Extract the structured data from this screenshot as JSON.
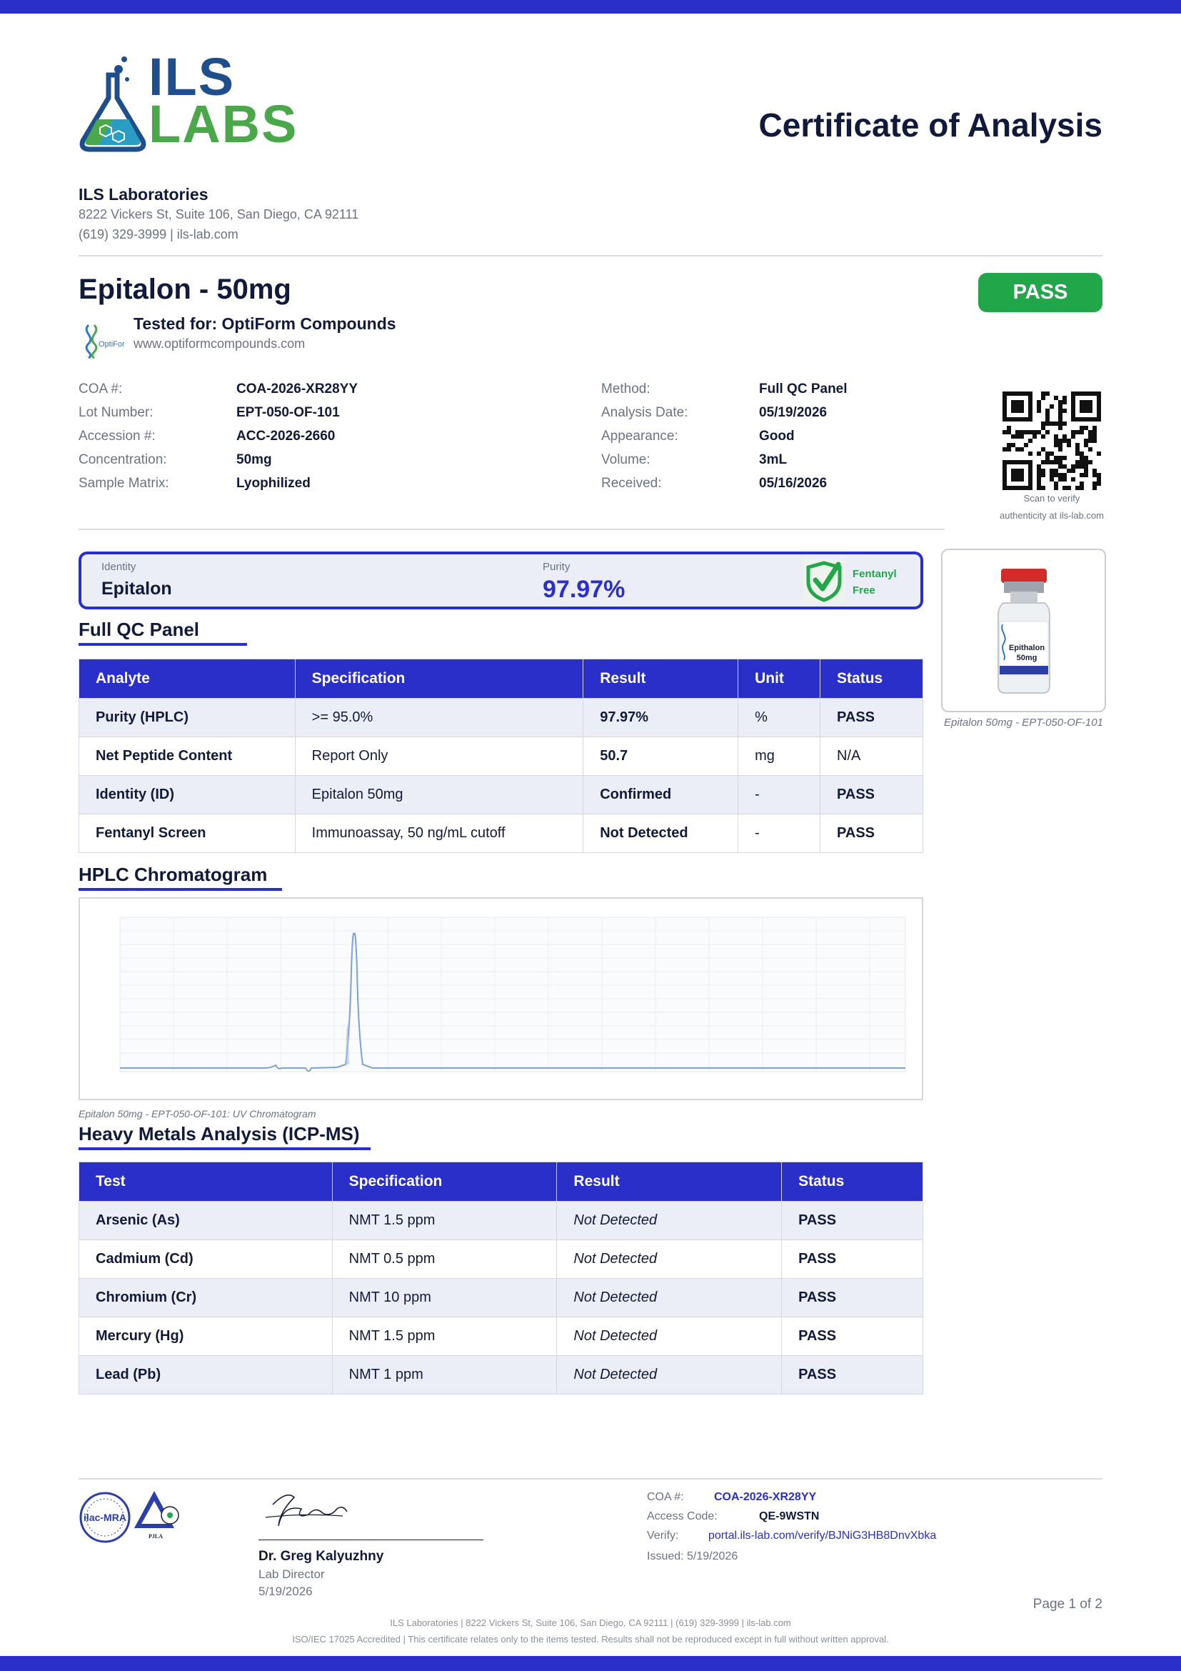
{
  "header": {
    "logo_top": "ILS",
    "logo_bottom": "LABS",
    "title": "Certificate of Analysis",
    "lab_name": "ILS Laboratories",
    "lab_address": "8222 Vickers St, Suite 106, San Diego, CA 92111",
    "lab_contact": "(619) 329-3999  |  ils-lab.com"
  },
  "product": {
    "name": "Epitalon - 50mg",
    "status": "PASS",
    "tested_for": "Tested for: OptiForm Compounds",
    "client_url": "www.optiformcompounds.com"
  },
  "info_left": [
    {
      "label": "COA #:",
      "value": "COA-2026-XR28YY"
    },
    {
      "label": "Lot Number:",
      "value": "EPT-050-OF-101"
    },
    {
      "label": "Accession #:",
      "value": "ACC-2026-2660"
    },
    {
      "label": "Concentration:",
      "value": "50mg"
    },
    {
      "label": "Sample Matrix:",
      "value": "Lyophilized"
    }
  ],
  "info_right": [
    {
      "label": "Method:",
      "value": "Full QC Panel"
    },
    {
      "label": "Analysis Date:",
      "value": "05/19/2026"
    },
    {
      "label": "Appearance:",
      "value": "Good"
    },
    {
      "label": "Volume:",
      "value": "3mL"
    },
    {
      "label": "Received:",
      "value": "05/16/2026"
    }
  ],
  "qr": {
    "caption1": "Scan to verify",
    "caption2": "authenticity at ils-lab.com"
  },
  "summary": {
    "identity_label": "Identity",
    "identity_value": "Epitalon",
    "purity_label": "Purity",
    "purity_value": "97.97%",
    "fentanyl_line1": "Fentanyl",
    "fentanyl_line2": "Free"
  },
  "vial": {
    "label1": "Epithalon",
    "label2": "50mg",
    "caption": "Epitalon 50mg - EPT-050-OF-101"
  },
  "qc": {
    "title": "Full QC Panel",
    "headers": [
      "Analyte",
      "Specification",
      "Result",
      "Unit",
      "Status"
    ],
    "rows": [
      [
        "Purity (HPLC)",
        ">= 95.0%",
        "97.97%",
        "%",
        "PASS"
      ],
      [
        "Net Peptide Content",
        "Report Only",
        "50.7",
        "mg",
        "N/A"
      ],
      [
        "Identity (ID)",
        "Epitalon 50mg",
        "Confirmed",
        "-",
        "PASS"
      ],
      [
        "Fentanyl Screen",
        "Immunoassay, 50 ng/mL cutoff",
        "Not Detected",
        "-",
        "PASS"
      ]
    ]
  },
  "hplc": {
    "title": "HPLC Chromatogram",
    "caption": "Epitalon 50mg - EPT-050-OF-101: UV Chromatogram"
  },
  "metals": {
    "title": "Heavy Metals Analysis (ICP-MS)",
    "headers": [
      "Test",
      "Specification",
      "Result",
      "Status"
    ],
    "rows": [
      [
        "Arsenic (As)",
        "NMT 1.5 ppm",
        "Not Detected",
        "PASS"
      ],
      [
        "Cadmium (Cd)",
        "NMT 0.5 ppm",
        "Not Detected",
        "PASS"
      ],
      [
        "Chromium (Cr)",
        "NMT 10 ppm",
        "Not Detected",
        "PASS"
      ],
      [
        "Mercury (Hg)",
        "NMT 1.5 ppm",
        "Not Detected",
        "PASS"
      ],
      [
        "Lead (Pb)",
        "NMT 1 ppm",
        "Not Detected",
        "PASS"
      ]
    ]
  },
  "signature": {
    "name": "Dr. Greg Kalyuzhny",
    "role": "Lab Director",
    "date": "5/19/2026"
  },
  "accreditation": {
    "logo1": "ilac-MRA",
    "logo2": "PJLA"
  },
  "verify": {
    "coa_label": "COA #:",
    "coa_value": "COA-2026-XR28YY",
    "access_label": "Access Code:",
    "access_value": "QE-9WSTN",
    "verify_label": "Verify:",
    "verify_value": "portal.ils-lab.com/verify/BJNiG3HB8DnvXbka",
    "issued": "Issued: 5/19/2026"
  },
  "footer": {
    "page": "Page 1 of 2",
    "line1": "ILS Laboratories  |  8222 Vickers St, Suite 106, San Diego, CA 92111  |  (619) 329-3999  |  ils-lab.com",
    "line2": "ISO/IEC 17025 Accredited  |  This certificate relates only to the items tested. Results shall not be reproduced except in full without written approval."
  },
  "colors": {
    "accent": "#2b2fc9",
    "pass": "#22a64a",
    "logo_blue": "#1f4e8c",
    "logo_green": "#4aa84a"
  }
}
